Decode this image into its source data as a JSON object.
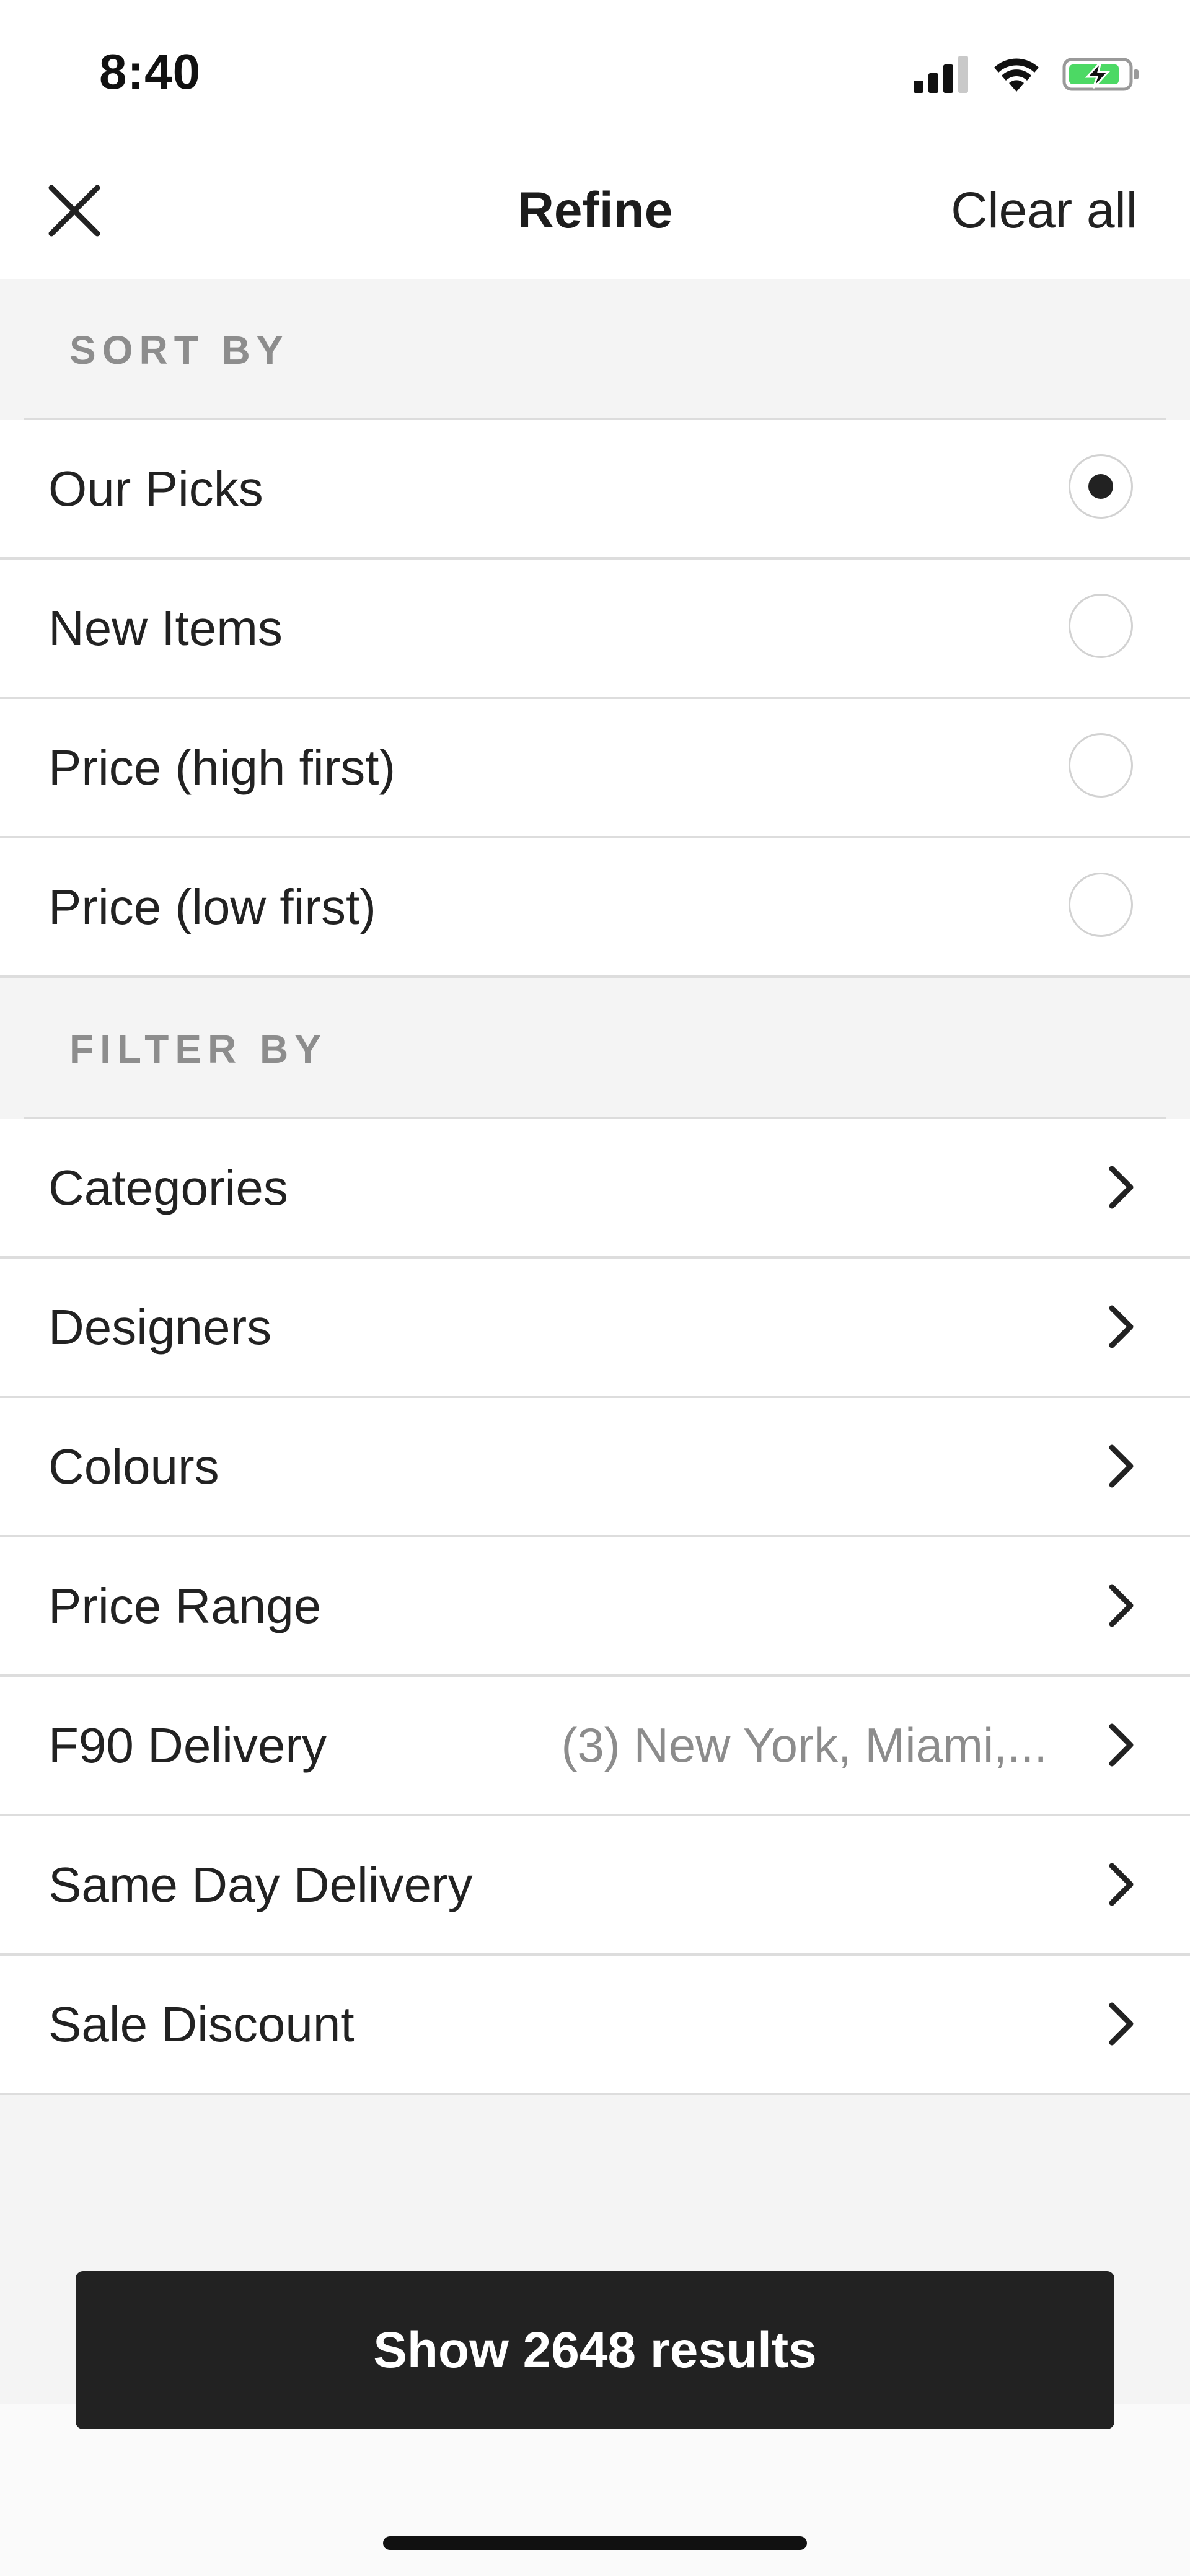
{
  "status_bar": {
    "time": "8:40"
  },
  "nav": {
    "title": "Refine",
    "clear_all_label": "Clear all"
  },
  "sort": {
    "header": "SORT BY",
    "options": [
      {
        "label": "Our Picks",
        "selected": true
      },
      {
        "label": "New Items",
        "selected": false
      },
      {
        "label": "Price (high first)",
        "selected": false
      },
      {
        "label": "Price (low first)",
        "selected": false
      }
    ]
  },
  "filter": {
    "header": "FILTER BY",
    "items": [
      {
        "label": "Categories",
        "value": ""
      },
      {
        "label": "Designers",
        "value": ""
      },
      {
        "label": "Colours",
        "value": ""
      },
      {
        "label": "Price Range",
        "value": ""
      },
      {
        "label": "F90 Delivery",
        "value": "(3) New York, Miami,..."
      },
      {
        "label": "Same Day Delivery",
        "value": ""
      },
      {
        "label": "Sale Discount",
        "value": ""
      }
    ]
  },
  "footer": {
    "show_results_label": "Show 2648 results"
  },
  "colors": {
    "primary_dark": "#222222",
    "background": "#f4f4f4",
    "battery_charging": "#4cd964"
  },
  "icons": [
    "cellular-signal-icon",
    "wifi-icon",
    "battery-charging-icon",
    "close-icon",
    "chevron-right-icon"
  ]
}
